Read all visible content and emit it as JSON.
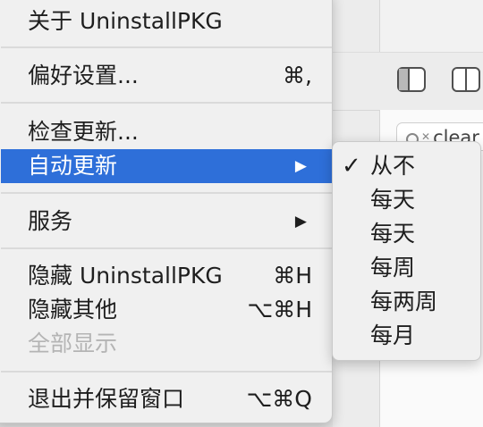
{
  "background_window": {
    "search_text": "clear"
  },
  "menu": {
    "items": [
      {
        "label": "关于 UninstallPKG",
        "shortcut": ""
      },
      {
        "label": "偏好设置...",
        "shortcut": "⌘,"
      },
      {
        "label": "检查更新...",
        "shortcut": ""
      },
      {
        "label": "自动更新",
        "shortcut": "",
        "submenu_arrow": "▶"
      },
      {
        "label": "服务",
        "shortcut": "",
        "submenu_arrow": "▶"
      },
      {
        "label": "隐藏 UninstallPKG",
        "shortcut": "⌘H"
      },
      {
        "label": "隐藏其他",
        "shortcut": "⌥⌘H"
      },
      {
        "label": "全部显示",
        "shortcut": ""
      },
      {
        "label": "退出并保留窗口",
        "shortcut": "⌥⌘Q"
      }
    ]
  },
  "submenu": {
    "checkmark": "✓",
    "items": [
      {
        "label": "从不"
      },
      {
        "label": "每天"
      },
      {
        "label": "每天"
      },
      {
        "label": "每周"
      },
      {
        "label": "每两周"
      },
      {
        "label": "每月"
      }
    ]
  },
  "colors": {
    "highlight": "#2e6fd9",
    "menu_background": "#f0f0f0",
    "disabled_text": "#b4b4b4"
  }
}
